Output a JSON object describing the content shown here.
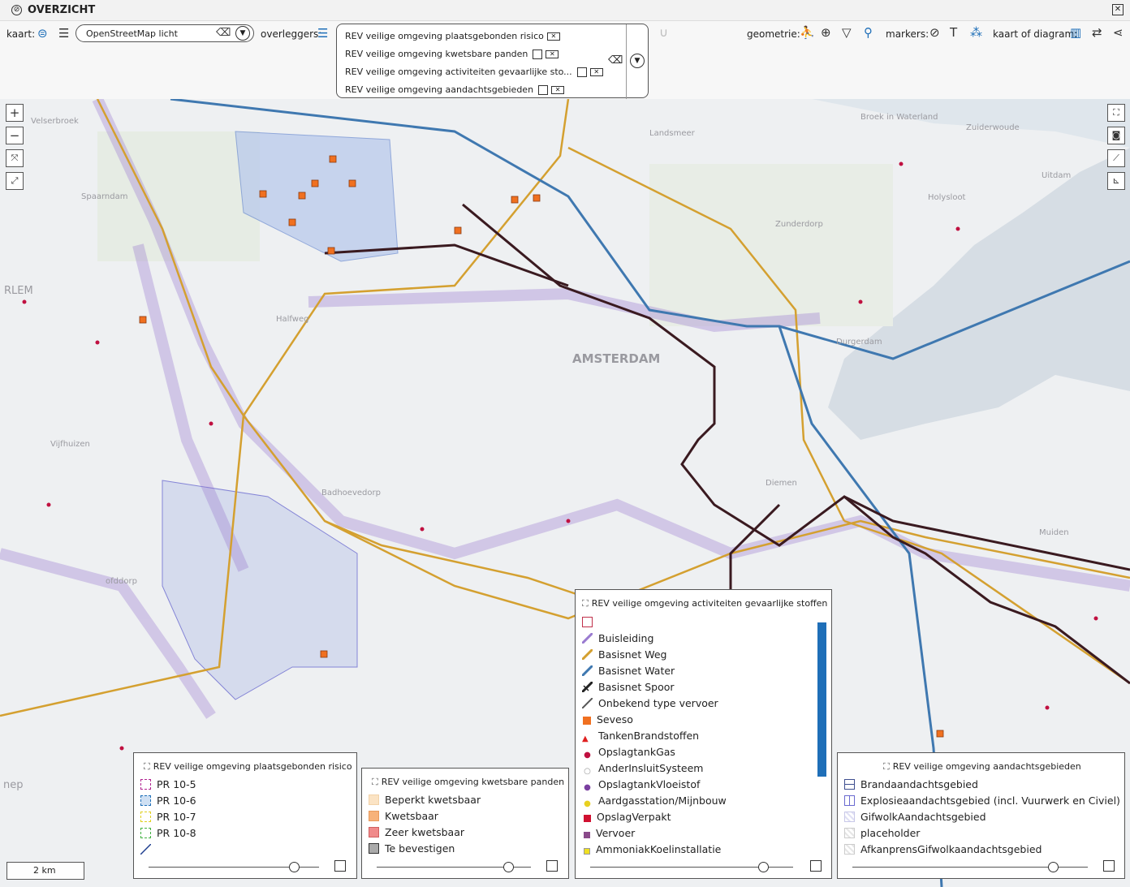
{
  "title": "OVERZICHT",
  "toolbar": {
    "kaart_label": "kaart:",
    "basemap": "OpenStreetMap licht",
    "overleggers_label": "overleggers:",
    "overlays": [
      "REV veilige omgeving plaatsgebonden risico",
      "REV veilige omgeving kwetsbare panden",
      "REV veilige omgeving activiteiten gevaarlijke sto...",
      "REV veilige omgeving aandachtsgebieden"
    ],
    "geometrie_label": "geometrie:",
    "markers_label": "markers:",
    "kaart_diagram_label": "kaart of diagram:"
  },
  "map": {
    "places": [
      {
        "name": "Landsmeer"
      },
      {
        "name": "Broek in Waterland"
      },
      {
        "name": "Zuiderwoude"
      },
      {
        "name": "Uitdam"
      },
      {
        "name": "Holysloot"
      },
      {
        "name": "Zunderdorp"
      },
      {
        "name": "Velserbroek"
      },
      {
        "name": "Spaarndam"
      },
      {
        "name": "RLEM"
      },
      {
        "name": "Halfweg"
      },
      {
        "name": "AMSTERDAM"
      },
      {
        "name": "Durgerdam"
      },
      {
        "name": "Vijfhuizen"
      },
      {
        "name": "Badhoevedorp"
      },
      {
        "name": "Diemen"
      },
      {
        "name": "Muiden"
      },
      {
        "name": "ofddorp"
      },
      {
        "name": "nep"
      }
    ],
    "scale": "2 km"
  },
  "legends": {
    "pr": {
      "title": "REV veilige omgeving plaatsgebonden risico",
      "items": [
        {
          "label": "PR 10-5",
          "color": "#b0208f"
        },
        {
          "label": "PR 10-6",
          "color": "#1f6fb8"
        },
        {
          "label": "PR 10-7",
          "color": "#e0d020"
        },
        {
          "label": "PR 10-8",
          "color": "#40b040"
        },
        {
          "label": "",
          "color": "#1f3f8f"
        }
      ],
      "opacity": 0.85
    },
    "kp": {
      "title": "REV veilige omgeving kwetsbare panden",
      "items": [
        {
          "label": "Beperkt kwetsbaar",
          "color": "#fbe3c4"
        },
        {
          "label": "Kwetsbaar",
          "color": "#f7b27a"
        },
        {
          "label": "Zeer kwetsbaar",
          "color": "#f08a8a"
        },
        {
          "label": "Te bevestigen",
          "color": "#aaaaaa"
        }
      ],
      "opacity": 0.85
    },
    "act": {
      "title": "REV veilige omgeving activiteiten gevaarlijke stoffen",
      "items": [
        {
          "label": "",
          "color": "#c0304a"
        },
        {
          "label": "Buisleiding",
          "color": "#9a7bd0"
        },
        {
          "label": "Basisnet Weg",
          "color": "#d4a030"
        },
        {
          "label": "Basisnet Water",
          "color": "#3f78b0"
        },
        {
          "label": "Basisnet Spoor",
          "color": "#222222"
        },
        {
          "label": "Onbekend type vervoer",
          "color": "#555555"
        },
        {
          "label": "Seveso",
          "color": "#f07020"
        },
        {
          "label": "TankenBrandstoffen",
          "color": "#e02020"
        },
        {
          "label": "OpslagtankGas",
          "color": "#c01040"
        },
        {
          "label": "AnderInsluitSysteem",
          "color": "#ffffff"
        },
        {
          "label": "OpslagtankVloeistof",
          "color": "#7a3fa0"
        },
        {
          "label": "Aardgasstation/Mijnbouw",
          "color": "#e8d020"
        },
        {
          "label": "OpslagVerpakt",
          "color": "#d01030"
        },
        {
          "label": "Vervoer",
          "color": "#8a4a8a"
        },
        {
          "label": "AmmoniakKoelinstallatie",
          "color": "#f0e020"
        }
      ],
      "opacity": 0.85
    },
    "aand": {
      "title": "REV veilige omgeving aandachtsgebieden",
      "items": [
        {
          "label": "Brandaandachtsgebied",
          "color": "#3f4f8f"
        },
        {
          "label": "Explosieaandachtsgebied (incl. Vuurwerk en Civiel)",
          "color": "#6a6ad0"
        },
        {
          "label": "GifwolkAandachtsgebied",
          "color": "#c8c8e8"
        },
        {
          "label": "placeholder",
          "color": "#cccccc"
        },
        {
          "label": "AfkanprensGifwolkaandachtsgebied",
          "color": "#cccccc"
        }
      ],
      "opacity": 0.85
    }
  },
  "colors": {
    "accent": "#1f6fb8",
    "road": "#d4a030",
    "water": "#3f78b0",
    "pipe": "#9a7bd0",
    "rail": "#3a1a20"
  }
}
